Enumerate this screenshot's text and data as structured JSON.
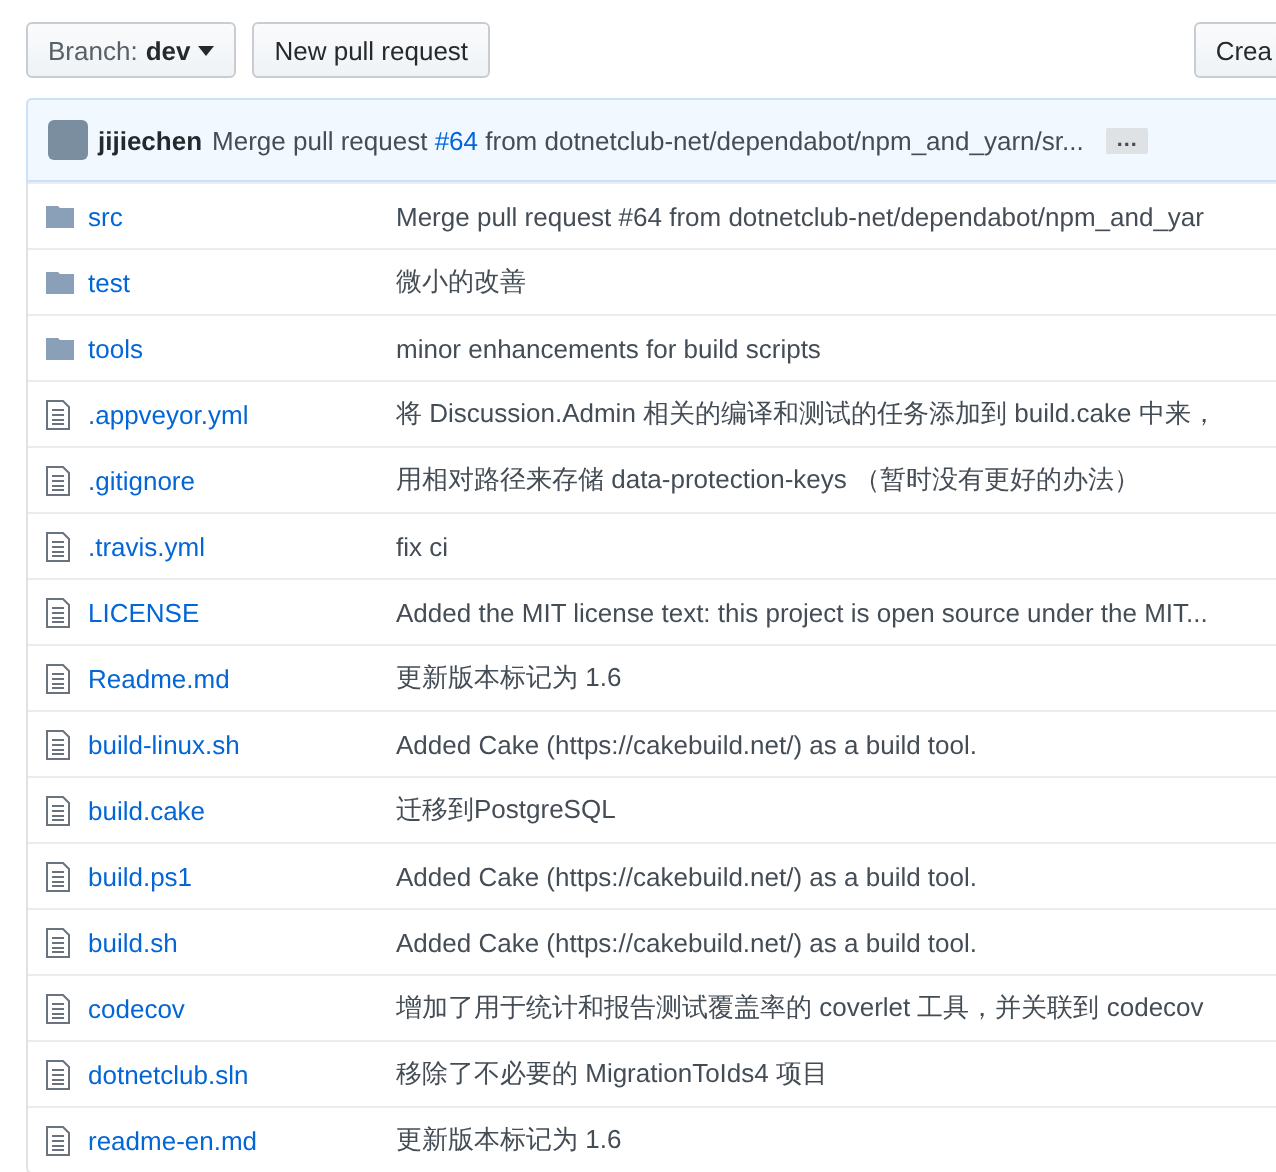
{
  "toolbar": {
    "branch_label": "Branch:",
    "branch_name": "dev",
    "new_pull_request": "New pull request",
    "create_button": "Crea"
  },
  "latest_commit": {
    "author": "jijiechen",
    "message_before": "Merge pull request ",
    "link": "#64",
    "message_after": " from dotnetclub-net/dependabot/npm_and_yarn/sr...",
    "expand": "…"
  },
  "files": [
    {
      "kind": "folder",
      "name": "src",
      "message": "Merge pull request #64 from dotnetclub-net/dependabot/npm_and_yar"
    },
    {
      "kind": "folder",
      "name": "test",
      "message": "微小的改善"
    },
    {
      "kind": "folder",
      "name": "tools",
      "message": "minor enhancements for build scripts"
    },
    {
      "kind": "file",
      "name": ".appveyor.yml",
      "message": "将 Discussion.Admin 相关的编译和测试的任务添加到 build.cake 中来，"
    },
    {
      "kind": "file",
      "name": ".gitignore",
      "message": "用相对路径来存储 data-protection-keys （暂时没有更好的办法）"
    },
    {
      "kind": "file",
      "name": ".travis.yml",
      "message": "fix ci"
    },
    {
      "kind": "file",
      "name": "LICENSE",
      "message": "Added the MIT license text: this project is open source under the MIT..."
    },
    {
      "kind": "file",
      "name": "Readme.md",
      "message": "更新版本标记为 1.6"
    },
    {
      "kind": "file",
      "name": "build-linux.sh",
      "message": "Added Cake (https://cakebuild.net/) as a build tool."
    },
    {
      "kind": "file",
      "name": "build.cake",
      "message": "迁移到PostgreSQL"
    },
    {
      "kind": "file",
      "name": "build.ps1",
      "message": "Added Cake (https://cakebuild.net/) as a build tool."
    },
    {
      "kind": "file",
      "name": "build.sh",
      "message": "Added Cake (https://cakebuild.net/) as a build tool."
    },
    {
      "kind": "file",
      "name": "codecov",
      "message": "增加了用于统计和报告测试覆盖率的 coverlet 工具，并关联到 codecov"
    },
    {
      "kind": "file",
      "name": "dotnetclub.sln",
      "message": "移除了不必要的 MigrationToIds4 项目"
    },
    {
      "kind": "file",
      "name": "readme-en.md",
      "message": "更新版本标记为 1.6"
    }
  ]
}
